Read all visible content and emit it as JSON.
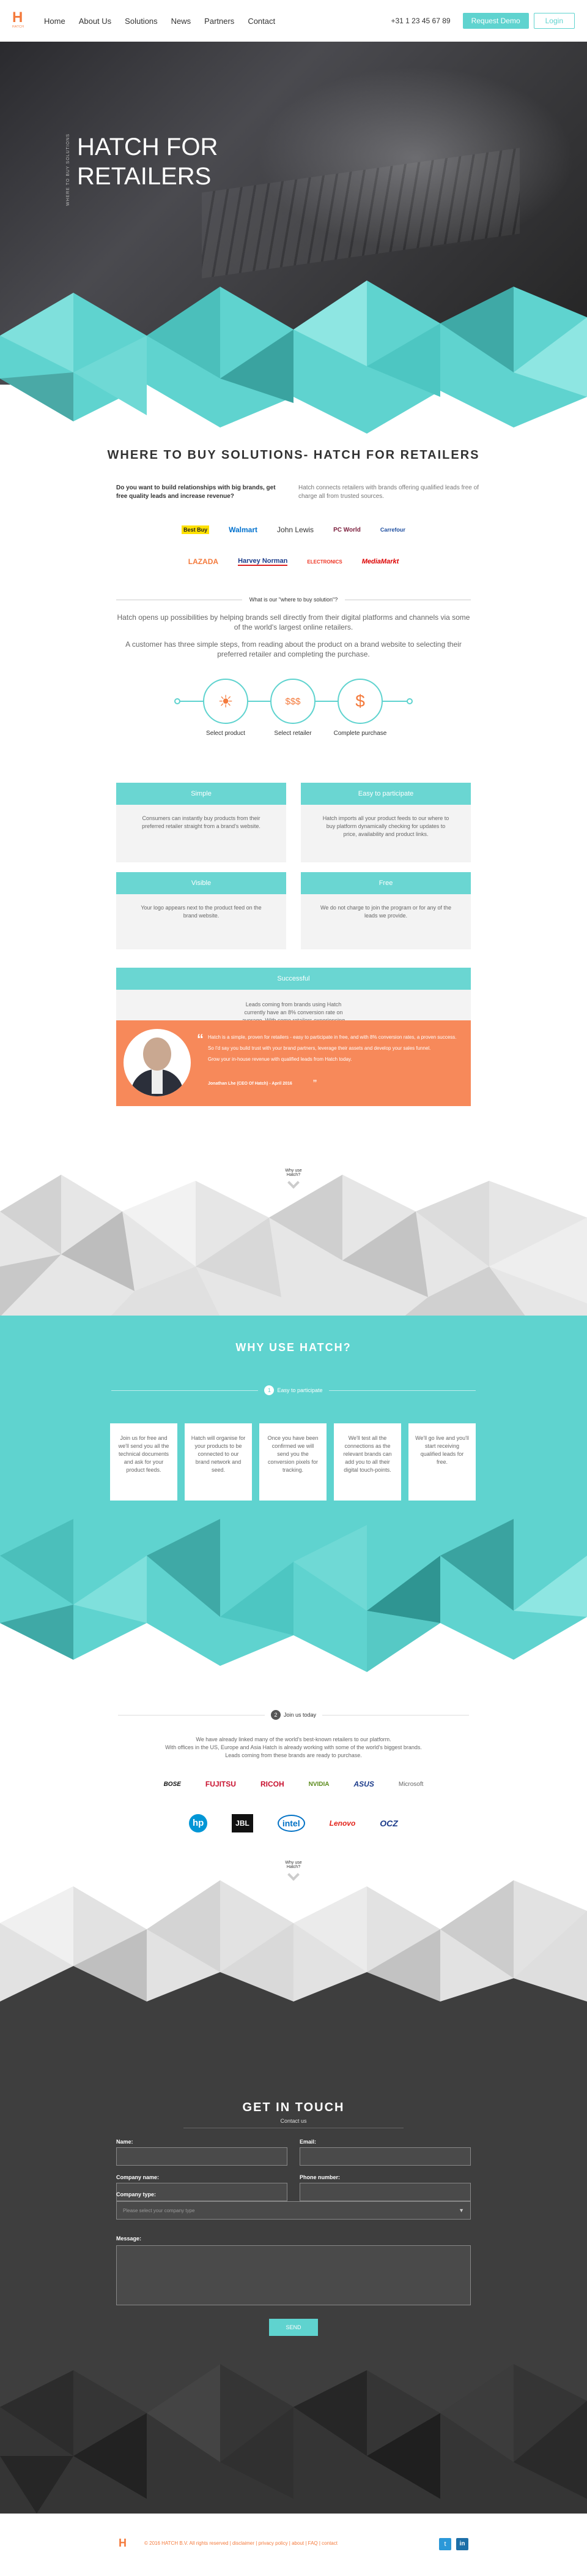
{
  "header": {
    "logo_letter": "H",
    "logo_sub": "HATCH",
    "nav": [
      "Home",
      "About Us",
      "Solutions",
      "News",
      "Partners",
      "Contact"
    ],
    "phone": "+31 1 23 45 67 89",
    "request_demo": "Request Demo",
    "login": "Login"
  },
  "hero": {
    "title": "HATCH FOR RETAILERS",
    "side_text": "WHERE TO BUY SOLUTIONS"
  },
  "where_to_buy": {
    "title": "WHERE TO BUY SOLUTIONS- HATCH FOR RETAILERS",
    "intro_left": "Do you want to build relationships with big brands, get free quality leads and increase revenue?",
    "intro_right": "Hatch connects retailers with brands offering qualified leads free of charge all from trusted sources.",
    "retailers_row1": [
      "Best Buy",
      "Walmart",
      "John Lewis",
      "PC World",
      "Carrefour"
    ],
    "retailers_row2": [
      "LAZADA",
      "Harvey Norman",
      "ELECTRONICS",
      "MediaMarkt"
    ],
    "divider_label": "What is our \"where to buy solution\"?",
    "para1": "Hatch opens up possibilities by helping brands sell directly from their digital platforms and channels via some of the world's largest online retailers.",
    "para2": "A customer has three simple steps, from reading about the product on a brand website to selecting their preferred retailer and completing the purchase.",
    "steps": [
      "Select product",
      "Select retailer",
      "Complete purchase"
    ]
  },
  "features": [
    {
      "title": "Simple",
      "text": "Consumers can instantly buy products from their preferred retailer straight from a brand's website."
    },
    {
      "title": "Easy to participate",
      "text": "Hatch imports all your product feeds to our where to buy platform dynamically checking for updates to price, availability and product links."
    },
    {
      "title": "Visible",
      "text": "Your logo appears next to the product feed on the brand website."
    },
    {
      "title": "Free",
      "text": "We do not charge to join the program or for any of the leads we provide."
    },
    {
      "title": "Successful",
      "text": "Leads coming from brands using Hatch currently have an 8% conversion rate on average. With some retailers experiencing 30% conversion rates."
    }
  ],
  "testimonial": {
    "text1": "Hatch is a simple, proven for retailers - easy to participate in free, and with 8% conversion rates, a proven success.",
    "text2": "So I'd say you build trust with your brand partners, leverage their assets and develop your sales funnel.",
    "text3": "Grow your in-house revenue with qualified leads from Hatch today.",
    "author": "Jonathan Lhe (CEO Of Hatch) - April 2016"
  },
  "scroll1": "Why use Hatch?",
  "why": {
    "title": "WHY USE HATCH?",
    "step_num": "1",
    "step_label": "Easy to participate",
    "cards": [
      "Join us for free and we'll send you all the technical documents and ask for your product feeds.",
      "Hatch will organise for your products to be connected to our brand network and seed.",
      "Once you have been confirmed we will send you the conversion pixels for tracking.",
      "We'll test all the connections as the relevant brands can add you to all their digital touch-points.",
      "We'll go live and you'll start receiving qualified leads for free."
    ]
  },
  "join": {
    "step_num": "2",
    "step_label": "Join us today",
    "para1": "We have already linked many of the world's best-known retailers to our platform.",
    "para2": "With offices in the US, Europe and Asia Hatch is already working with some of the world's biggest brands.",
    "para3": "Leads coming from these brands are ready to purchase.",
    "brands_row1": [
      "BOSE",
      "FUJITSU",
      "RICOH",
      "NVIDIA",
      "ASUS",
      "Microsoft"
    ],
    "brands_row2": [
      "hp",
      "JBL",
      "intel",
      "Lenovo",
      "OCZ"
    ]
  },
  "scroll2": "Why use Hatch?",
  "contact": {
    "title": "GET IN TOUCH",
    "subtitle": "Contact us",
    "name_label": "Name:",
    "email_label": "Email:",
    "company_label": "Company name:",
    "phone_label": "Phone number:",
    "type_label": "Company type:",
    "type_placeholder": "Please select your company type",
    "message_label": "Message:",
    "send": "SEND"
  },
  "footer": {
    "logo": "H",
    "copyright": "© 2016 HATCH B.V. All rights reserved | disclaimer | privacy policy | about | FAQ | contact",
    "twitter": "t",
    "linkedin": "in"
  },
  "colors": {
    "teal": "#5fd3cf",
    "orange": "#f47a3c",
    "dark": "#3e3e3e"
  }
}
